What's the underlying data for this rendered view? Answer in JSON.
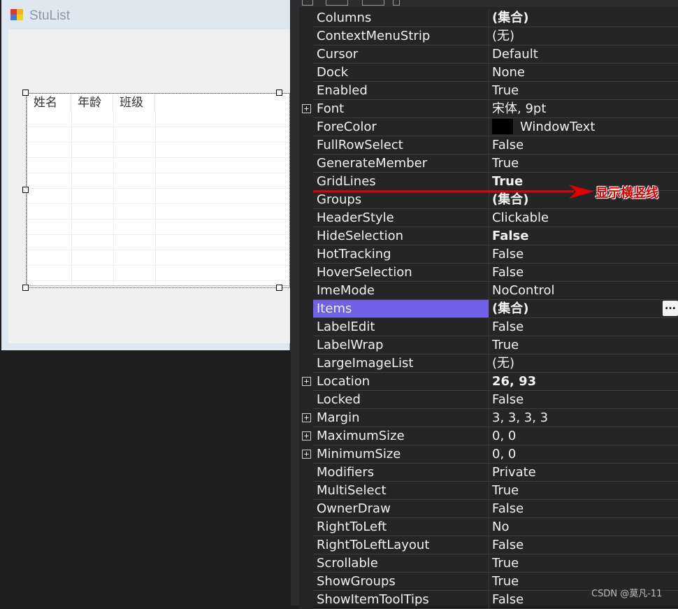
{
  "form": {
    "title": "StuList",
    "listview": {
      "columns": [
        "姓名",
        "年龄",
        "班级"
      ]
    }
  },
  "properties": [
    {
      "name": "Columns",
      "value": "(集合)",
      "bold": true,
      "expandable": false
    },
    {
      "name": "ContextMenuStrip",
      "value": "(无)",
      "bold": false,
      "expandable": false
    },
    {
      "name": "Cursor",
      "value": "Default",
      "bold": false,
      "expandable": false
    },
    {
      "name": "Dock",
      "value": "None",
      "bold": false,
      "expandable": false
    },
    {
      "name": "Enabled",
      "value": "True",
      "bold": false,
      "expandable": false
    },
    {
      "name": "Font",
      "value": "宋体, 9pt",
      "bold": false,
      "expandable": true
    },
    {
      "name": "ForeColor",
      "value": "WindowText",
      "bold": false,
      "expandable": false,
      "swatch": "#000000"
    },
    {
      "name": "FullRowSelect",
      "value": "False",
      "bold": false,
      "expandable": false
    },
    {
      "name": "GenerateMember",
      "value": "True",
      "bold": false,
      "expandable": false
    },
    {
      "name": "GridLines",
      "value": "True",
      "bold": true,
      "expandable": false
    },
    {
      "name": "Groups",
      "value": "(集合)",
      "bold": true,
      "expandable": false
    },
    {
      "name": "HeaderStyle",
      "value": "Clickable",
      "bold": false,
      "expandable": false
    },
    {
      "name": "HideSelection",
      "value": "False",
      "bold": true,
      "expandable": false
    },
    {
      "name": "HotTracking",
      "value": "False",
      "bold": false,
      "expandable": false
    },
    {
      "name": "HoverSelection",
      "value": "False",
      "bold": false,
      "expandable": false
    },
    {
      "name": "ImeMode",
      "value": "NoControl",
      "bold": false,
      "expandable": false
    },
    {
      "name": "Items",
      "value": "(集合)",
      "bold": true,
      "expandable": false,
      "selected": true,
      "ellipsis": "..."
    },
    {
      "name": "LabelEdit",
      "value": "False",
      "bold": false,
      "expandable": false
    },
    {
      "name": "LabelWrap",
      "value": "True",
      "bold": false,
      "expandable": false
    },
    {
      "name": "LargeImageList",
      "value": "(无)",
      "bold": false,
      "expandable": false
    },
    {
      "name": "Location",
      "value": "26, 93",
      "bold": true,
      "expandable": true
    },
    {
      "name": "Locked",
      "value": "False",
      "bold": false,
      "expandable": false
    },
    {
      "name": "Margin",
      "value": "3, 3, 3, 3",
      "bold": false,
      "expandable": true
    },
    {
      "name": "MaximumSize",
      "value": "0, 0",
      "bold": false,
      "expandable": true
    },
    {
      "name": "MinimumSize",
      "value": "0, 0",
      "bold": false,
      "expandable": true
    },
    {
      "name": "Modifiers",
      "value": "Private",
      "bold": false,
      "expandable": false
    },
    {
      "name": "MultiSelect",
      "value": "True",
      "bold": false,
      "expandable": false
    },
    {
      "name": "OwnerDraw",
      "value": "False",
      "bold": false,
      "expandable": false
    },
    {
      "name": "RightToLeft",
      "value": "No",
      "bold": false,
      "expandable": false
    },
    {
      "name": "RightToLeftLayout",
      "value": "False",
      "bold": false,
      "expandable": false
    },
    {
      "name": "Scrollable",
      "value": "True",
      "bold": false,
      "expandable": false
    },
    {
      "name": "ShowGroups",
      "value": "True",
      "bold": false,
      "expandable": false
    },
    {
      "name": "ShowItemToolTips",
      "value": "False",
      "bold": false,
      "expandable": false
    }
  ],
  "annotation": {
    "label": "显示横竖线",
    "color": "#e00000"
  },
  "watermark": "CSDN @莫凡-11",
  "colors": {
    "selected_row": "#7160e8",
    "grid_background": "#252526"
  }
}
